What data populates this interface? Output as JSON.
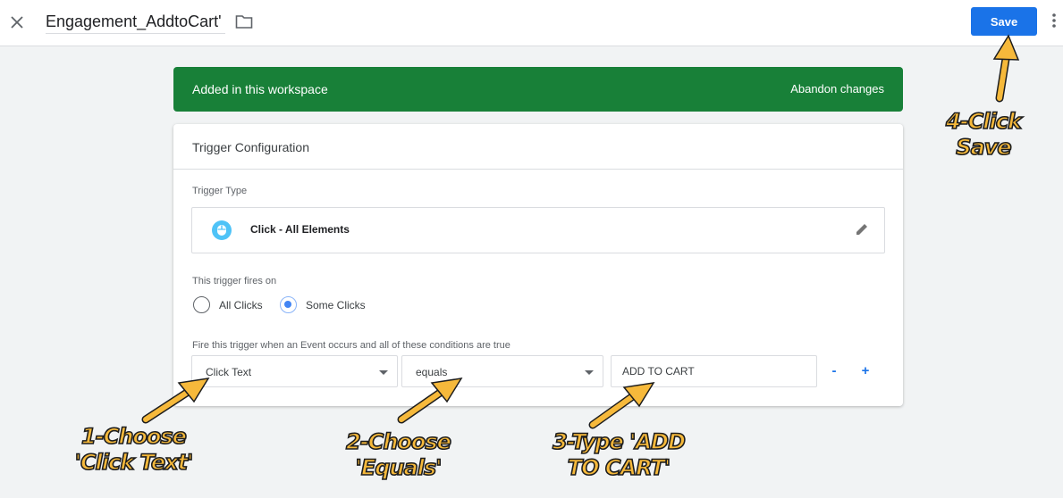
{
  "header": {
    "title": "Engagement_AddtoCart'",
    "save_label": "Save"
  },
  "banner": {
    "message": "Added in this workspace",
    "abandon_label": "Abandon changes",
    "color": "#188038"
  },
  "card": {
    "title": "Trigger Configuration",
    "trigger_type_label": "Trigger Type",
    "trigger_type_value": "Click - All Elements",
    "fires_on_label": "This trigger fires on",
    "radio_options": [
      "All Clicks",
      "Some Clicks"
    ],
    "radio_selected": "Some Clicks",
    "conditions_label": "Fire this trigger when an Event occurs and all of these conditions are true",
    "condition": {
      "variable": "Click Text",
      "operator": "equals",
      "value": "ADD TO CART"
    },
    "remove_label": "-",
    "add_label": "+"
  },
  "annotations": {
    "step1": [
      "1-Choose",
      "'Click Text'"
    ],
    "step2": [
      "2-Choose",
      "'Equals'"
    ],
    "step3": [
      "3-Type 'ADD",
      "TO CART'"
    ],
    "step4": [
      "4-Click",
      "Save"
    ]
  },
  "colors": {
    "accent": "#1a73e8",
    "annotation": "#f6b93b"
  }
}
